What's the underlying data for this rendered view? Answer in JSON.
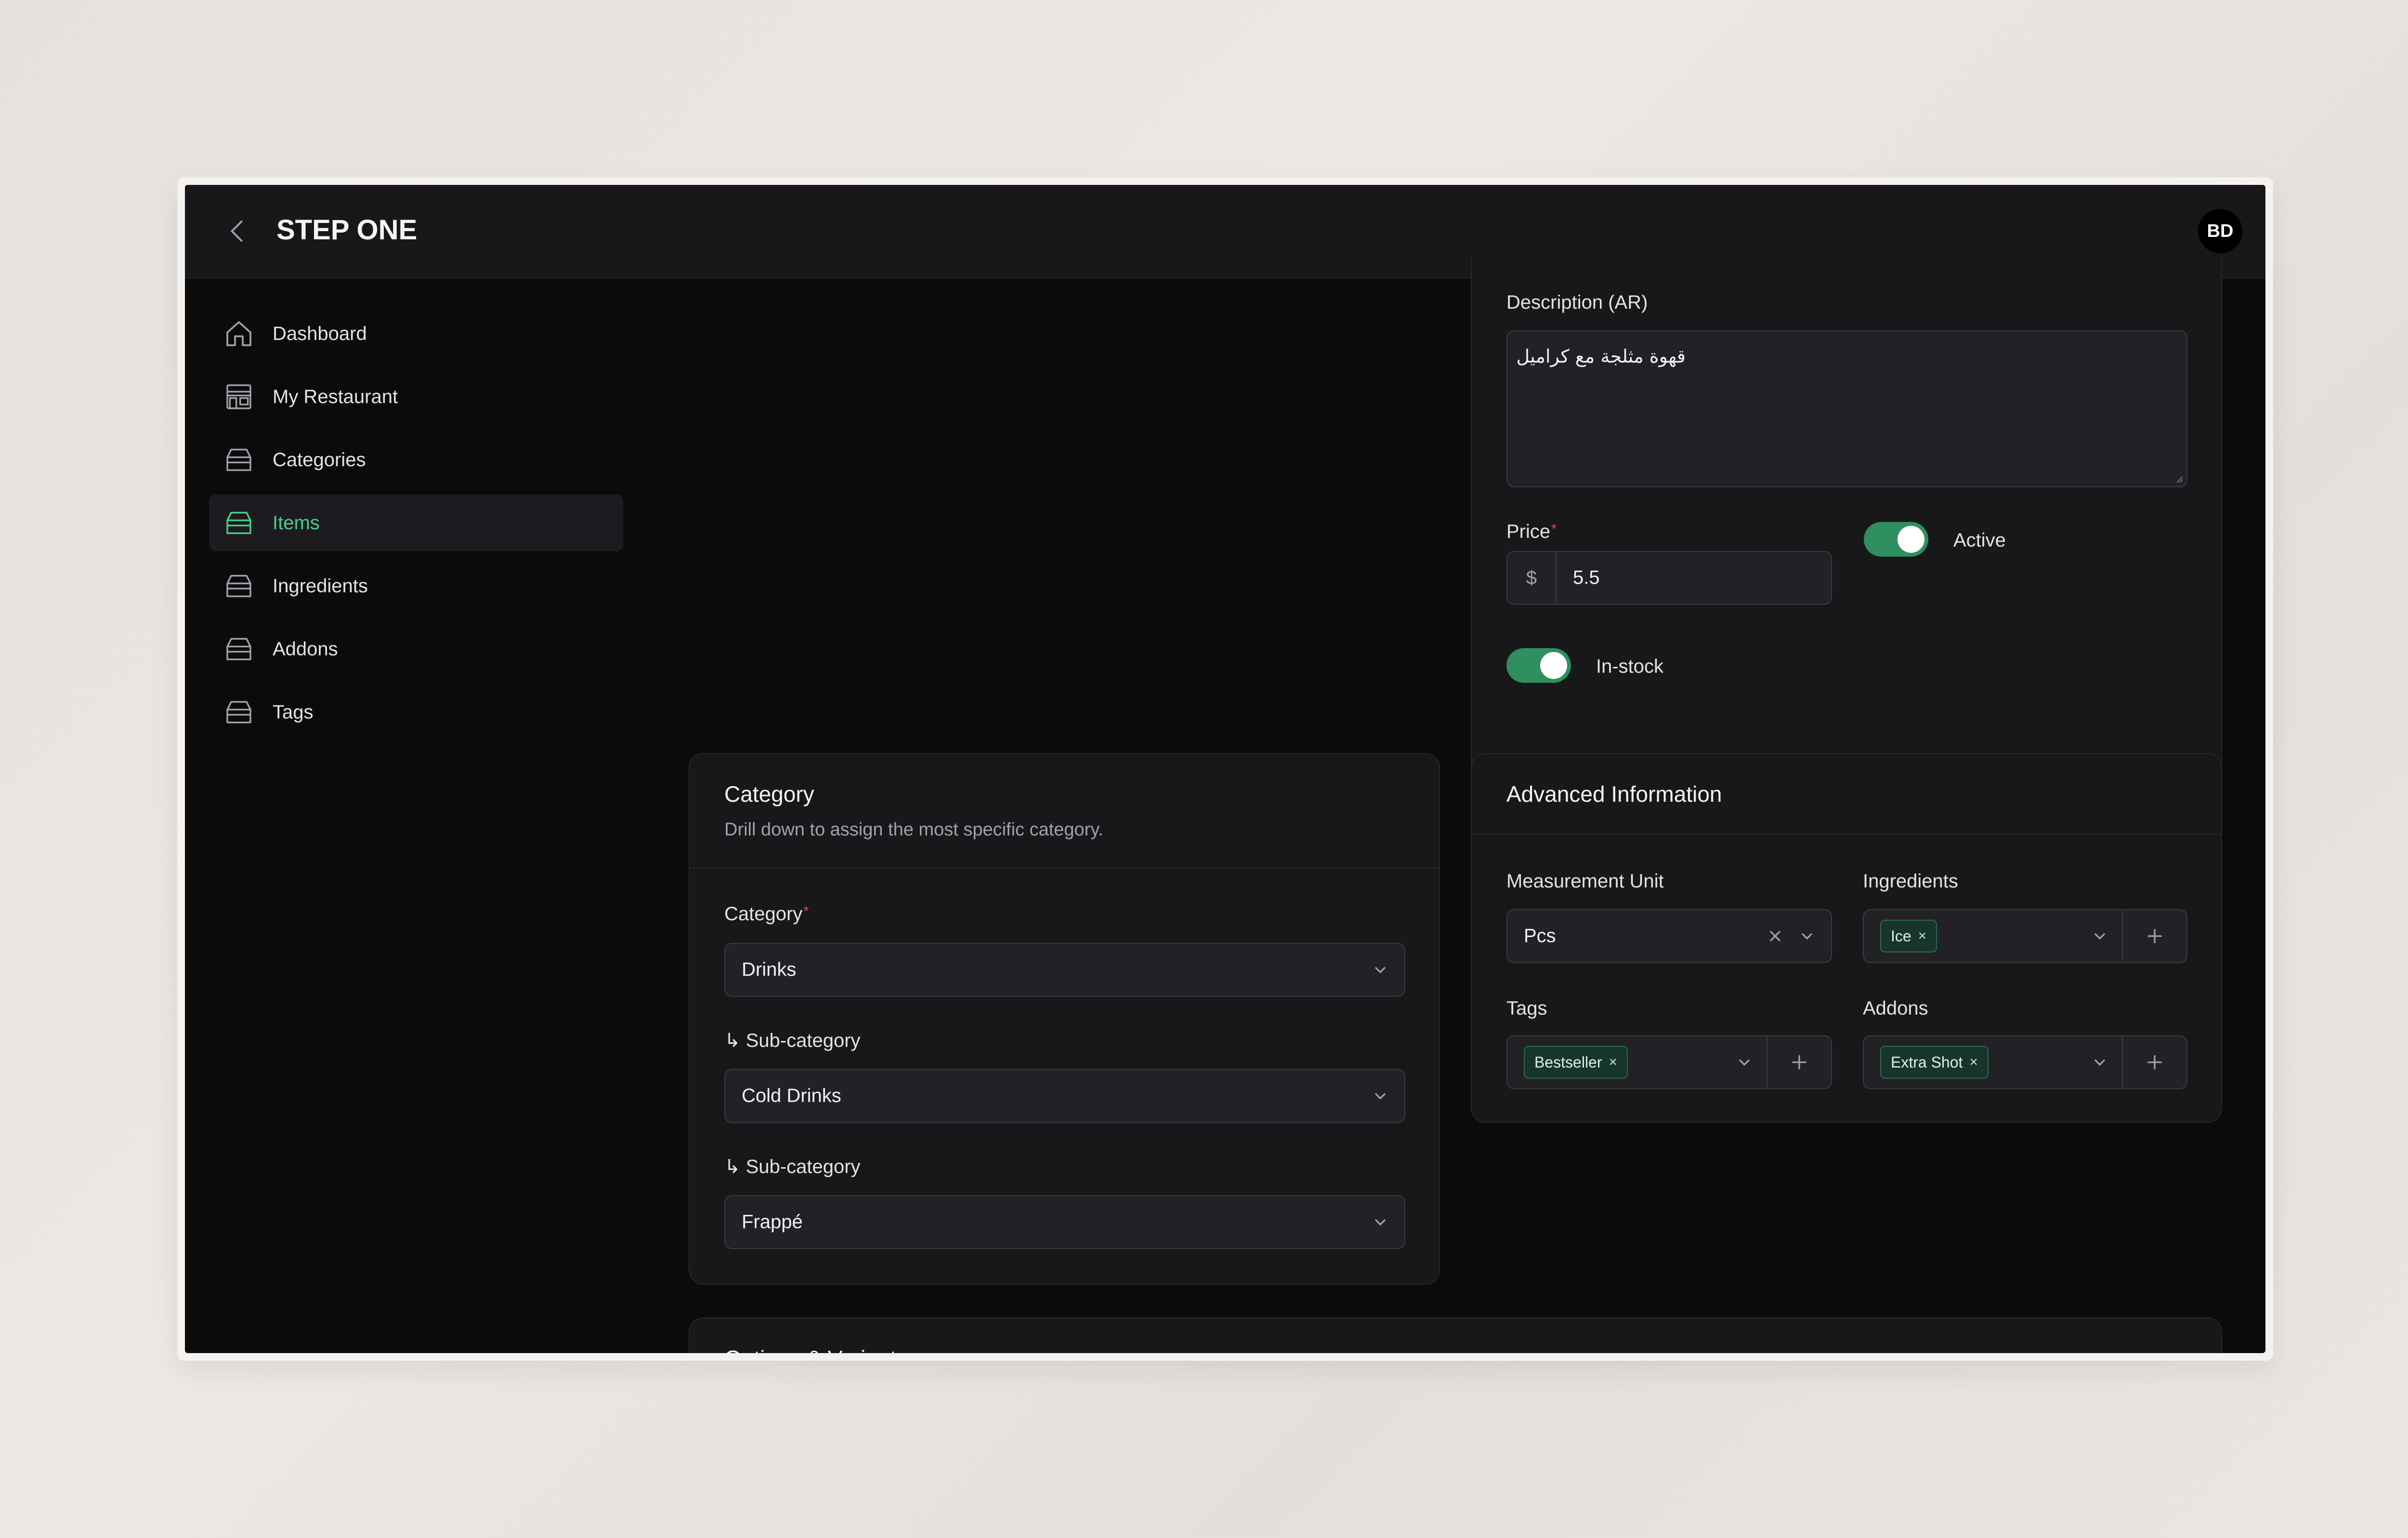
{
  "app": {
    "title": "STEP ONE",
    "avatar_initials": "BD"
  },
  "sidebar": {
    "items": [
      {
        "label": "Dashboard",
        "icon": "home-icon",
        "active": false
      },
      {
        "label": "My Restaurant",
        "icon": "store-icon",
        "active": false
      },
      {
        "label": "Categories",
        "icon": "tray-icon",
        "active": false
      },
      {
        "label": "Items",
        "icon": "tray-icon",
        "active": true
      },
      {
        "label": "Ingredients",
        "icon": "tray-icon",
        "active": false
      },
      {
        "label": "Addons",
        "icon": "tray-icon",
        "active": false
      },
      {
        "label": "Tags",
        "icon": "tray-icon",
        "active": false
      }
    ]
  },
  "details": {
    "description_ar_label": "Description (AR)",
    "description_ar_value": "قهوة مثلجة مع كراميل",
    "price_label": "Price",
    "currency_symbol": "$",
    "price_value": "5.5",
    "active_label": "Active",
    "active_on": true,
    "instock_label": "In-stock",
    "instock_on": true
  },
  "category_card": {
    "title": "Category",
    "subtitle": "Drill down to assign the most specific category.",
    "category_label": "Category",
    "category_value": "Drinks",
    "sub1_label": "↳ Sub-category",
    "sub1_value": "Cold Drinks",
    "sub2_label": "↳ Sub-category",
    "sub2_value": "Frappé"
  },
  "advanced_card": {
    "title": "Advanced Information",
    "unit_label": "Measurement Unit",
    "unit_value": "Pcs",
    "ingredients_label": "Ingredients",
    "ingredients_chips": [
      "Ice"
    ],
    "tags_label": "Tags",
    "tags_chips": [
      "Bestseller"
    ],
    "addons_label": "Addons",
    "addons_chips": [
      "Extra Shot"
    ]
  },
  "options_card": {
    "title": "Options & Variants"
  },
  "colors": {
    "accent": "#4ccb8a",
    "toggle_on": "#2f8f5e",
    "required": "#ef4444"
  }
}
